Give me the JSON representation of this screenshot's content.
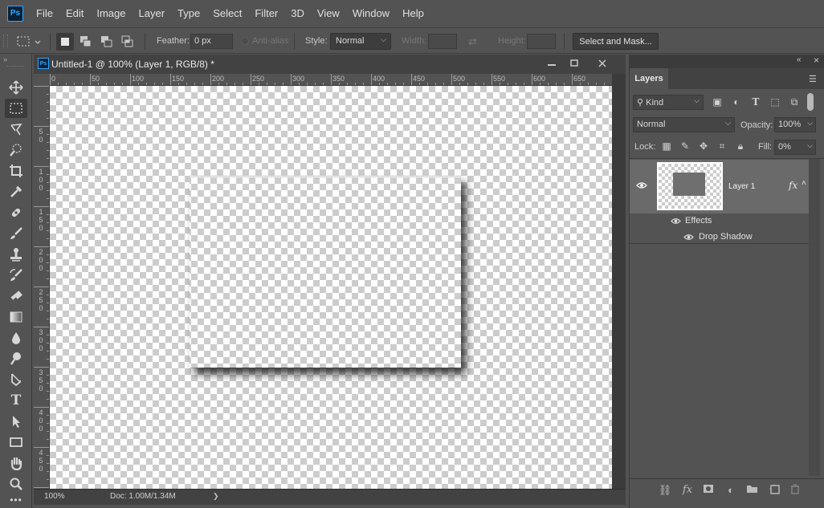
{
  "app": {
    "logo": "Ps"
  },
  "menu": [
    "File",
    "Edit",
    "Image",
    "Layer",
    "Type",
    "Select",
    "Filter",
    "3D",
    "View",
    "Window",
    "Help"
  ],
  "options": {
    "feather_label": "Feather:",
    "feather_value": "0 px",
    "antialias_label": "Anti-alias",
    "style_label": "Style:",
    "style_value": "Normal",
    "width_label": "Width:",
    "height_label": "Height:",
    "select_mask_label": "Select and Mask..."
  },
  "document": {
    "icon_text": "Ps",
    "title": "Untitled-1 @ 100% (Layer 1, RGB/8) *",
    "hruler": [
      "0",
      "50",
      "100",
      "150",
      "200",
      "250",
      "300",
      "350",
      "400",
      "450",
      "500",
      "550",
      "600",
      "650"
    ],
    "vruler": [
      "5\n0",
      "1\n0\n0",
      "1\n5\n0",
      "2\n0\n0",
      "2\n5\n0",
      "3\n0\n0",
      "3\n5\n0",
      "4\n0\n0",
      "4\n5\n0"
    ],
    "zoom": "100%",
    "doc_info": "Doc: 1.00M/1.34M",
    "status_arrow": "❯"
  },
  "layers_panel": {
    "tab_label": "Layers",
    "filter_kind": "Kind",
    "blend_mode": "Normal",
    "opacity_label": "Opacity:",
    "opacity_value": "100%",
    "lock_label": "Lock:",
    "fill_label": "Fill:",
    "fill_value": "0%",
    "layer_name": "Layer 1",
    "fx_label": "fx",
    "effects_label": "Effects",
    "drop_shadow_label": "Drop Shadow"
  },
  "colors": {
    "accent": "#31a8ff",
    "bg": "#535353",
    "canvas_bg": "#282828"
  }
}
